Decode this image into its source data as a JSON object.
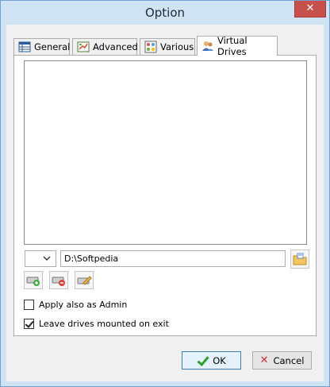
{
  "window": {
    "title": "Option",
    "close_glyph": "✕"
  },
  "tabs": [
    {
      "label": "General",
      "icon": "grid-icon"
    },
    {
      "label": "Advanced",
      "icon": "chart-icon"
    },
    {
      "label": "Various",
      "icon": "apps-icon"
    },
    {
      "label": "Virtual Drives",
      "icon": "users-icon",
      "active": true
    }
  ],
  "drives": {
    "list_items": [],
    "drive_letter": "",
    "path_value": "D:\\Softpedia"
  },
  "options": {
    "apply_admin": {
      "label": "Apply also as Admin",
      "checked": false
    },
    "leave_mounted": {
      "label": "Leave drives mounted on exit",
      "checked": true
    }
  },
  "buttons": {
    "ok": "OK",
    "cancel": "Cancel"
  },
  "colors": {
    "accent": "#3c7fb1",
    "close": "#c7504b",
    "ok_check": "#2f9e2f",
    "cancel_x": "#d03030"
  }
}
